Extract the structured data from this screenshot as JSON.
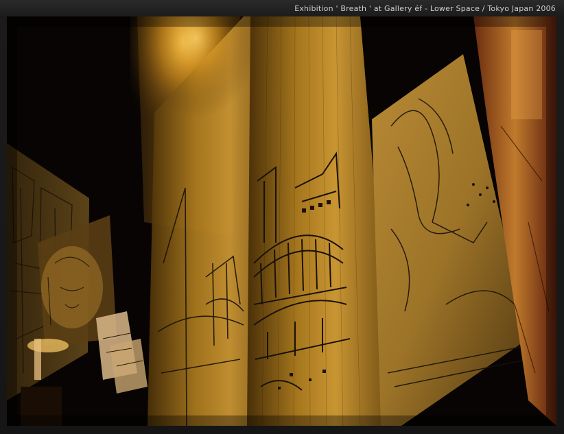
{
  "caption": {
    "text": "Exhibition  ' Breath '  at  Gallery éf - Lower Space  /   Tokyo Japan   2006"
  },
  "photo": {
    "subject_icon": "exhibition-photo",
    "palette": {
      "background": "#050302",
      "warm_light": "#f2b640",
      "amber": "#8a5a12",
      "ink": "#1a1208",
      "edge_red": "#7a2a12"
    }
  }
}
